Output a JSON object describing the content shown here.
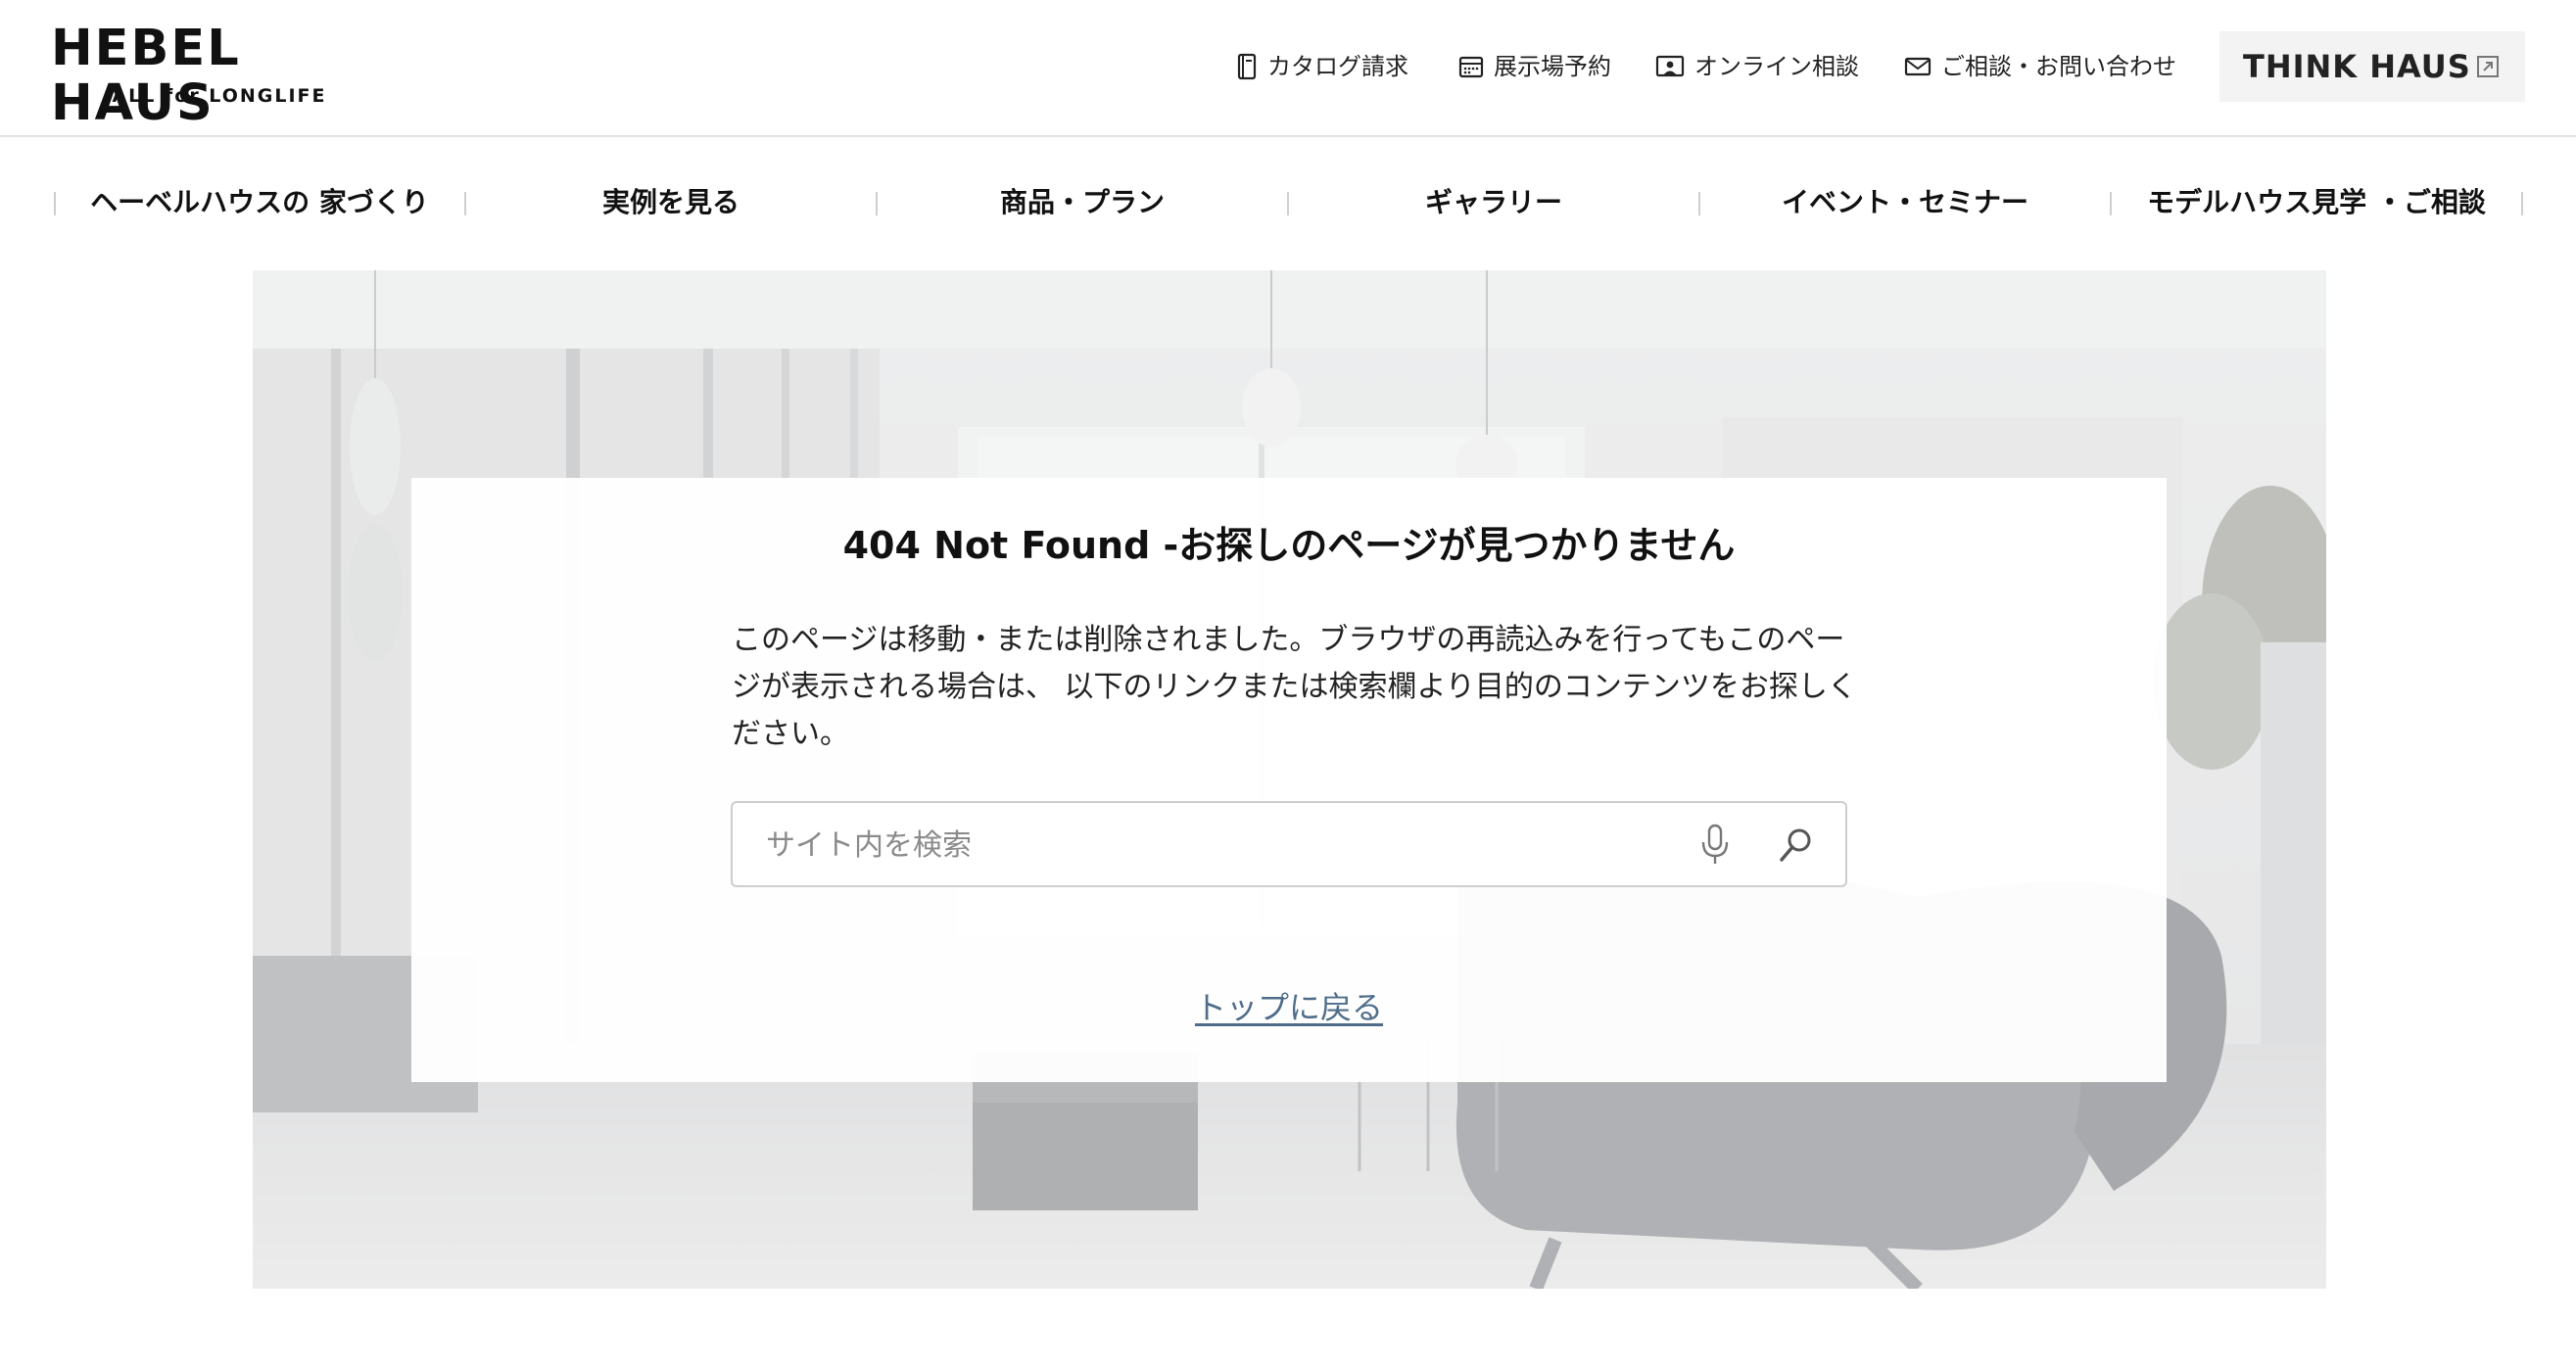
{
  "header": {
    "logo": {
      "main": "HEBEL HAUS",
      "sub": "ALL for LONGLIFE"
    },
    "utility_links": [
      {
        "label": "カタログ請求",
        "icon": "catalog-icon"
      },
      {
        "label": "展示場予約",
        "icon": "calendar-icon"
      },
      {
        "label": "オンライン相談",
        "icon": "online-consult-icon"
      },
      {
        "label": "ご相談・お問い合わせ",
        "icon": "mail-icon"
      }
    ],
    "think_haus": {
      "label": "THINK HAUS",
      "icon": "external-link-icon"
    }
  },
  "nav": {
    "items": [
      {
        "label": "ヘーベルハウスの 家づくり"
      },
      {
        "label": "実例を見る"
      },
      {
        "label": "商品・プラン"
      },
      {
        "label": "ギャラリー"
      },
      {
        "label": "イベント・セミナー"
      },
      {
        "label": "モデルハウス見学 ・ご相談"
      }
    ]
  },
  "main": {
    "title": "404 Not Found -お探しのページが見つかりません",
    "message": "このページは移動・または削除されました。ブラウザの再読込みを行ってもこのページが表示される場合は、 以下のリンクまたは検索欄より目的のコンテンツをお探しください。",
    "search": {
      "placeholder": "サイト内を検索",
      "value": "",
      "mic_icon": "microphone-icon",
      "search_icon": "search-icon"
    },
    "top_link": "トップに戻る"
  },
  "colors": {
    "text": "#111111",
    "link": "#4f6d8a",
    "header_border": "#e3e3e3",
    "think_bg": "#f3f3f3"
  }
}
